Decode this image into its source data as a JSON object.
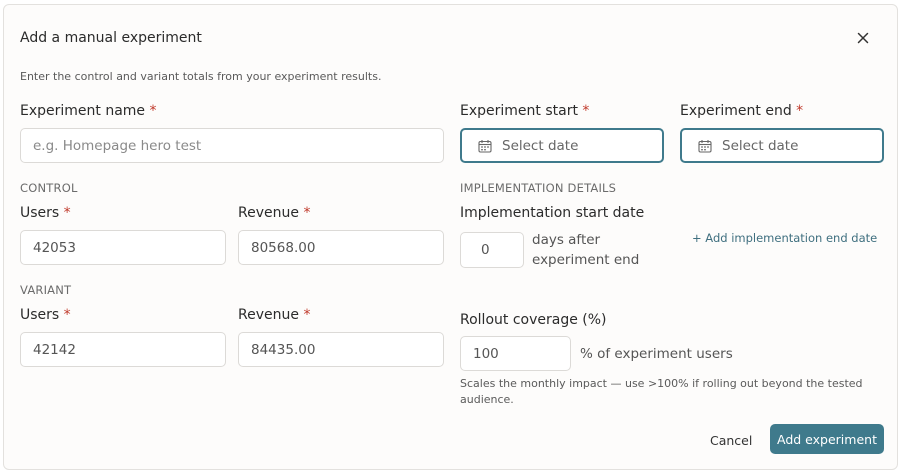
{
  "dialog": {
    "title": "Add a manual experiment",
    "description": "Enter the control and variant totals from your experiment results."
  },
  "experiment_name": {
    "label": "Experiment name",
    "required_mark": "*",
    "placeholder": "e.g. Homepage hero test",
    "value": ""
  },
  "experiment_start": {
    "label": "Experiment start",
    "required_mark": "*",
    "button_text": "Select date",
    "icon": "calendar-icon"
  },
  "experiment_end": {
    "label": "Experiment end",
    "required_mark": "*",
    "button_text": "Select date",
    "icon": "calendar-icon"
  },
  "control": {
    "section_label": "CONTROL",
    "users_label": "Users",
    "users_value": "42053",
    "revenue_label": "Revenue",
    "revenue_value": "80568.00",
    "required_mark": "*"
  },
  "variant": {
    "section_label": "VARIANT",
    "users_label": "Users",
    "users_value": "42142",
    "revenue_label": "Revenue",
    "revenue_value": "84435.00",
    "required_mark": "*"
  },
  "implementation": {
    "section_label": "IMPLEMENTATION DETAILS",
    "start_label": "Implementation start date",
    "days_value": "0",
    "days_suffix_line1": "days after",
    "days_suffix_line2": "experiment end",
    "add_end_link": "+ Add implementation end date"
  },
  "rollout": {
    "label": "Rollout coverage (%)",
    "value": "100",
    "suffix": "% of experiment users",
    "hint": "Scales the monthly impact — use >100% if rolling out beyond the tested audience."
  },
  "actions": {
    "cancel_label": "Cancel",
    "submit_label": "Add experiment"
  },
  "colors": {
    "accent": "#3f7a8c",
    "required": "#c0392b",
    "link": "#3f6f7f"
  }
}
